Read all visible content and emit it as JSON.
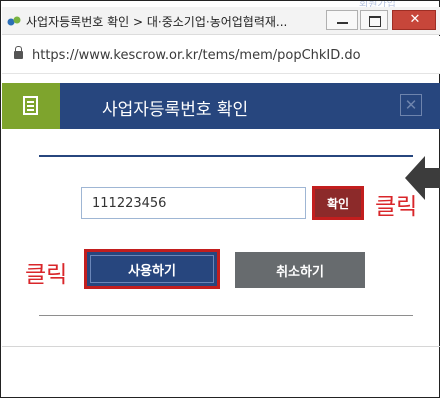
{
  "background_page": {
    "peek_text": "회원가입"
  },
  "window": {
    "title": "사업자등록번호 확인 > 대·중소기업·농어업협력재...",
    "close_glyph": "✕"
  },
  "address_bar": {
    "url": "https://www.kescrow.or.kr/tems/mem/popChkID.do"
  },
  "dialog": {
    "title": "사업자등록번호 확인",
    "close_glyph": "✕",
    "business_number_value": "111223456",
    "confirm_label": "확인",
    "use_label": "사용하기",
    "cancel_label": "취소하기"
  },
  "annotations": {
    "click_confirm": "클릭",
    "click_use": "클릭"
  },
  "colors": {
    "header_blue": "#27467e",
    "header_green": "#7ea42d",
    "highlight_red": "#c21e1e",
    "annotation_red": "#d9262a",
    "cancel_gray": "#676b6e",
    "confirm_brown": "#8c2a2a"
  },
  "icons": [
    "site-favicon",
    "minimize-icon",
    "maximize-icon",
    "close-icon",
    "lock-icon",
    "document-icon",
    "dialog-close-icon",
    "pointer-arrow-icon"
  ]
}
